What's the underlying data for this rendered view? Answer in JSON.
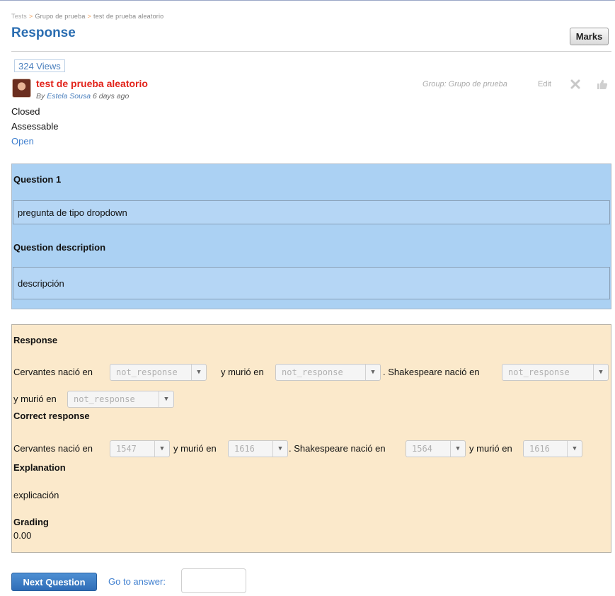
{
  "breadcrumb": {
    "items": [
      "Tests",
      "Grupo de prueba",
      "test de prueba aleatorio"
    ],
    "separator": ">"
  },
  "page": {
    "title": "Response",
    "marks_label": "Marks"
  },
  "post": {
    "views": "324 Views",
    "title": "test de prueba aleatorio",
    "by_prefix": "By",
    "author": "Estela Sousa",
    "time_ago": "6 days ago",
    "group": "Group: Grupo de prueba",
    "edit_label": "Edit",
    "status_closed": "Closed",
    "status_assessable": "Assessable",
    "open_link": "Open"
  },
  "question": {
    "heading": "Question 1",
    "text": "pregunta de tipo dropdown",
    "description_heading": "Question description",
    "description": "descripción"
  },
  "response": {
    "heading": "Response",
    "line1": {
      "p1": "Cervantes nació en",
      "p2": "y murió en",
      "p3": ". Shakespeare nació en",
      "p4": "y murió en"
    },
    "selects": [
      "not_response",
      "not_response",
      "not_response",
      "not_response"
    ],
    "correct_heading": "Correct response",
    "correct_line": {
      "p1": "Cervantes nació en",
      "p2": "y murió en",
      "p3": ". Shakespeare nació en",
      "p4": "y murió en"
    },
    "correct_selects": [
      "1547",
      "1616",
      "1564",
      "1616"
    ],
    "explanation_heading": "Explanation",
    "explanation": "explicación",
    "grading_heading": "Grading",
    "grading": "0.00"
  },
  "footer": {
    "next_label": "Next Question",
    "goto_label": "Go to answer:",
    "goto_value": ""
  },
  "icons": {
    "delete": "close-x-icon",
    "like": "thumbs-up-icon",
    "dropdown_arrow": "triangle-down-icon"
  },
  "colors": {
    "title_blue": "#2a6db1",
    "link_blue": "#3f7fcf",
    "post_title_red": "#e2231a",
    "question_panel": "#abd1f3",
    "response_panel": "#fbe9cb",
    "button_blue": "#3a7bc8"
  }
}
